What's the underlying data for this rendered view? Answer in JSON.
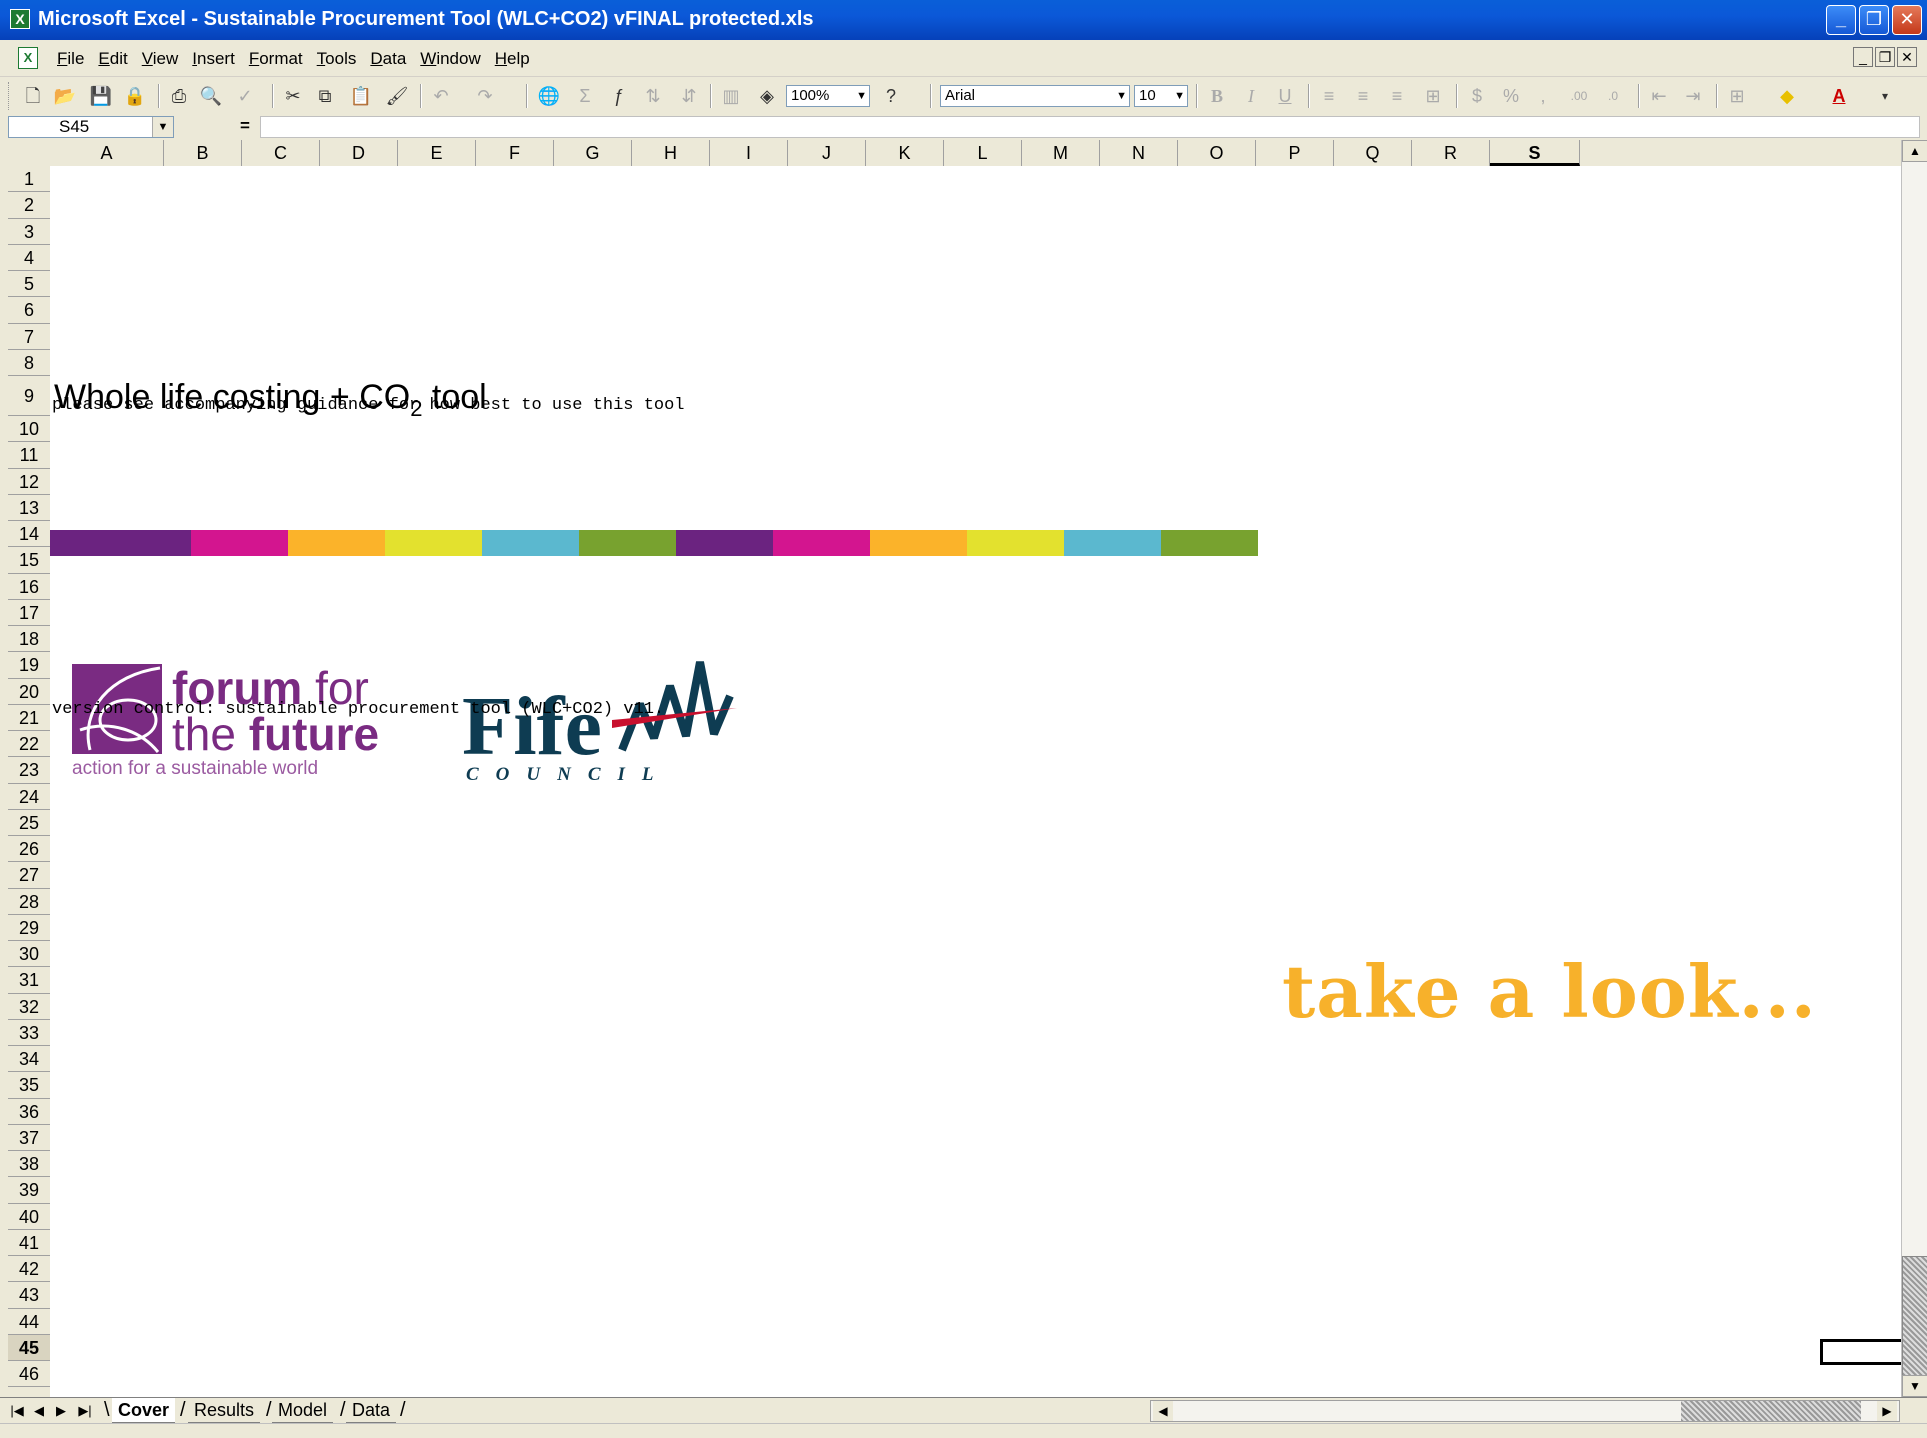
{
  "window": {
    "title": "Microsoft Excel - Sustainable Procurement Tool (WLC+CO2) vFINAL protected.xls",
    "app_icon": "excel-icon"
  },
  "menu": {
    "items": [
      "File",
      "Edit",
      "View",
      "Insert",
      "Format",
      "Tools",
      "Data",
      "Window",
      "Help"
    ]
  },
  "toolbar": {
    "zoom": "100%",
    "font": "Arial",
    "font_size": "10"
  },
  "formula_bar": {
    "cell_ref": "S45",
    "equals": "=",
    "formula": ""
  },
  "columns": [
    "A",
    "B",
    "C",
    "D",
    "E",
    "F",
    "G",
    "H",
    "I",
    "J",
    "K",
    "L",
    "M",
    "N",
    "O",
    "P",
    "Q",
    "R",
    "S"
  ],
  "rows": [
    "1",
    "2",
    "3",
    "4",
    "5",
    "6",
    "7",
    "8",
    "9",
    "10",
    "11",
    "12",
    "13",
    "14",
    "15",
    "16",
    "17",
    "18",
    "19",
    "20",
    "21",
    "22",
    "23",
    "24",
    "25",
    "26",
    "27",
    "28",
    "29",
    "30",
    "31",
    "32",
    "33",
    "34",
    "35",
    "36",
    "37",
    "38",
    "39",
    "40",
    "41",
    "42",
    "43",
    "44",
    "45",
    "46"
  ],
  "active_column": "S",
  "active_row": "45",
  "sheet": {
    "title_main": "Whole life costing + CO",
    "title_sub": "2",
    "title_tail": " tool",
    "guidance": "please see accompanying guidance for how best to use this tool",
    "version": "version control: sustainable procurement tool (WLC+CO2) v11.",
    "cta": "take a look...",
    "strip_colors": [
      "#6b2380",
      "#d3158f",
      "#fbb32a",
      "#e3e12e",
      "#5bb8cf",
      "#78a22f",
      "#6b2380",
      "#d3158f",
      "#fbb32a",
      "#e3e12e",
      "#5bb8cf",
      "#78a22f"
    ],
    "fftf_logo": {
      "word1": "forum",
      "word2": " for",
      "word3": "the ",
      "word4": "future",
      "tagline": "action for a sustainable world",
      "color": "#7a2b82"
    },
    "fife_logo": {
      "word": "Fife",
      "sub": "COUNCIL",
      "color": "#0e3c52",
      "accent": "#c8102e"
    }
  },
  "tabs": [
    "Cover",
    "Results",
    "Model",
    "Data"
  ],
  "active_tab": "Cover"
}
